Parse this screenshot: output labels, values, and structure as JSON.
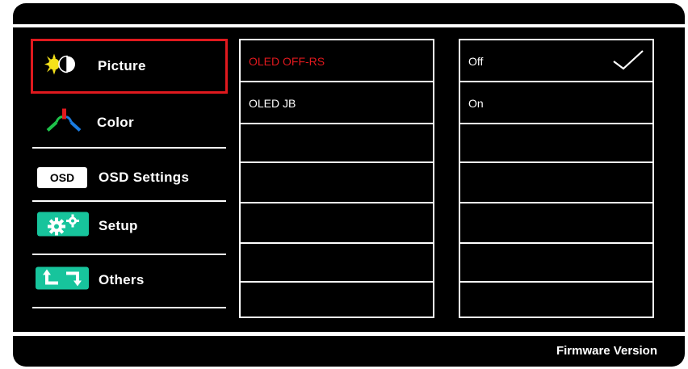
{
  "menu": {
    "items": [
      {
        "label": "Picture",
        "icon": "picture-icon",
        "selected": true
      },
      {
        "label": "Color",
        "icon": "color-icon"
      },
      {
        "label": "OSD Settings",
        "icon": "osd-icon",
        "badge": "OSD"
      },
      {
        "label": "Setup",
        "icon": "gears-icon"
      },
      {
        "label": "Others",
        "icon": "others-icon"
      }
    ]
  },
  "submenu": {
    "items": [
      {
        "label": "OLED OFF-RS",
        "highlighted": true
      },
      {
        "label": "OLED JB"
      }
    ],
    "highlight_color": "#e0191e"
  },
  "options": {
    "items": [
      {
        "label": "Off",
        "checked": true
      },
      {
        "label": "On"
      }
    ]
  },
  "footer": {
    "label": "Firmware Version"
  },
  "colors": {
    "accent": "#e0191e",
    "teal": "#17c49c",
    "background": "#000000",
    "foreground": "#ffffff"
  }
}
